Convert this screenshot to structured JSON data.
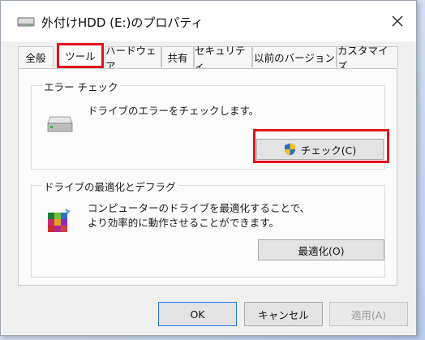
{
  "window": {
    "title": "外付けHDD (E:)のプロパティ",
    "close_label": "×"
  },
  "tabs": [
    {
      "label": "全般"
    },
    {
      "label": "ツール"
    },
    {
      "label": "ハードウェア"
    },
    {
      "label": "共有"
    },
    {
      "label": "セキュリティ"
    },
    {
      "label": "以前のバージョン"
    },
    {
      "label": "カスタマイズ"
    }
  ],
  "active_tab": "ツール",
  "error_check": {
    "group_title": "エラー チェック",
    "description": "ドライブのエラーをチェックします。",
    "button_label": "チェック(C)"
  },
  "optimize": {
    "group_title": "ドライブの最適化とデフラグ",
    "description_line1": "コンピューターのドライブを最適化することで、",
    "description_line2": "より効率的に動作させることができます。",
    "button_label": "最適化(O)"
  },
  "footer": {
    "ok_label": "OK",
    "cancel_label": "キャンセル",
    "apply_label": "適用(A)"
  },
  "icons": {
    "title": "drive-icon",
    "close": "close-icon",
    "error_check": "hard-drive-icon",
    "check_button": "uac-shield-icon",
    "optimize": "defrag-icon"
  },
  "colors": {
    "highlight": "#e1141e",
    "dialog_bg": "#f0f0f0",
    "panel_bg": "#fbfbfb"
  }
}
